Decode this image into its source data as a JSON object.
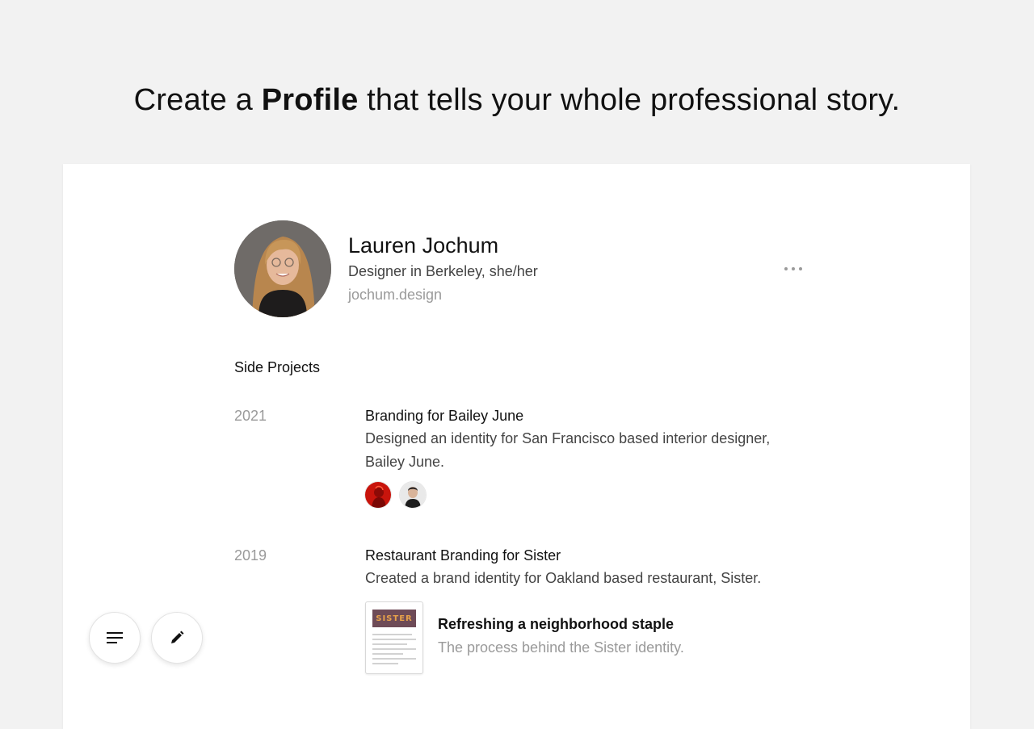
{
  "headline": {
    "prefix": "Create a ",
    "bold": "Profile",
    "suffix": " that tells your whole professional story."
  },
  "profile": {
    "name": "Lauren Jochum",
    "subtitle": "Designer in Berkeley, she/her",
    "website": "jochum.design",
    "more_icon": "more-horizontal-icon"
  },
  "section": {
    "title": "Side Projects"
  },
  "projects": [
    {
      "year": "2021",
      "title": "Branding for Bailey June",
      "description": "Designed an identity for San Francisco based interior designer, Bailey June.",
      "collaborators": [
        "collaborator-avatar-red",
        "collaborator-avatar-man"
      ]
    },
    {
      "year": "2019",
      "title": "Restaurant Branding for Sister",
      "description": "Created a brand identity for Oakland based restaurant, Sister.",
      "article": {
        "title": "Refreshing a neighborhood staple",
        "subtitle": "The process behind the Sister identity.",
        "thumb_logo": "SISTER"
      }
    }
  ],
  "fabs": {
    "menu_icon": "menu-lines-icon",
    "edit_icon": "pencil-icon"
  },
  "colors": {
    "background": "#f2f2f2",
    "card": "#ffffff",
    "muted": "#9a9a9a",
    "thumb_header": "#6e4b57",
    "thumb_logo": "#e8a24a"
  }
}
